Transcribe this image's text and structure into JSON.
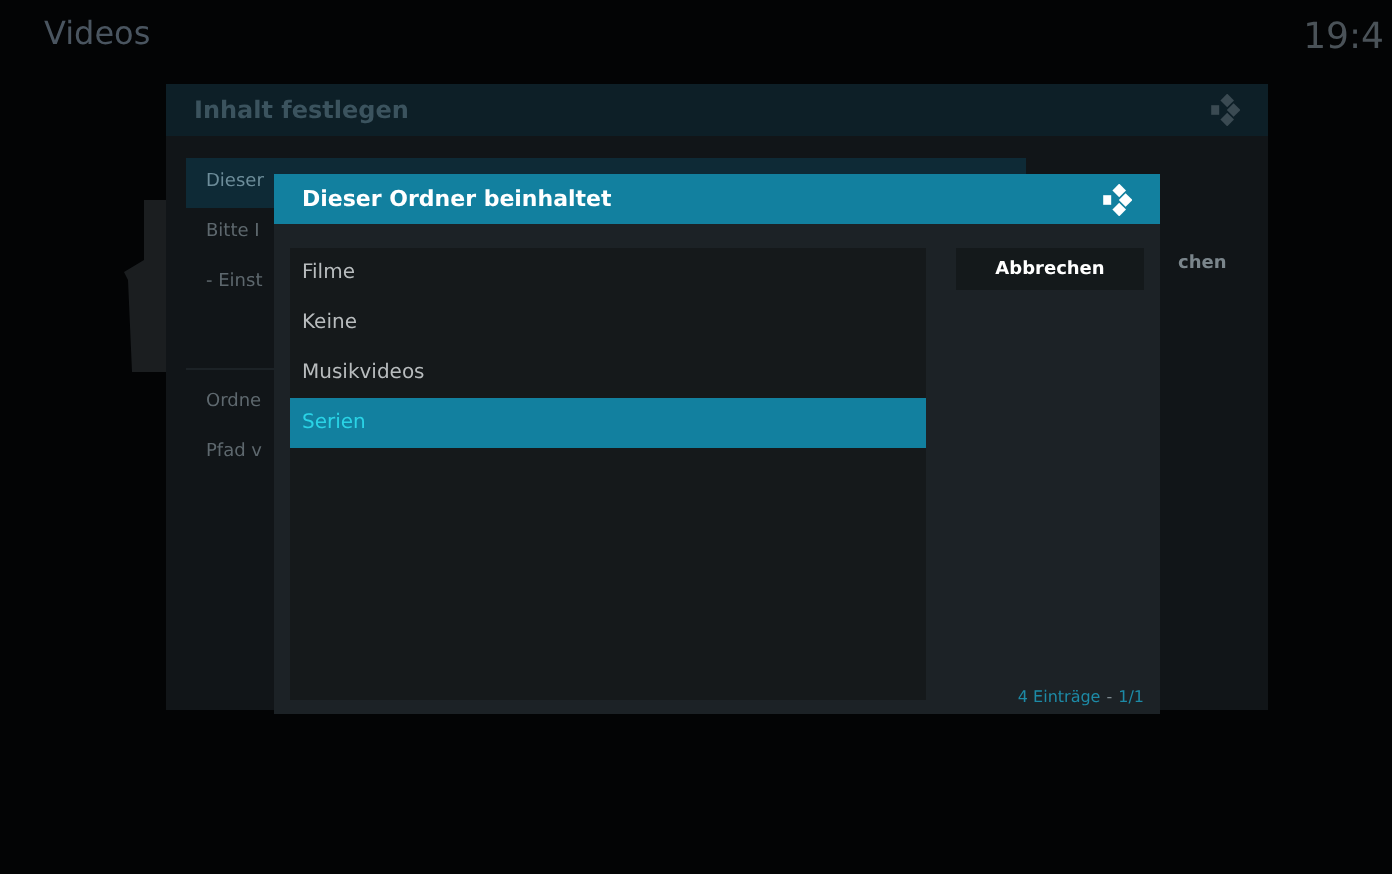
{
  "header": {
    "title": "Videos",
    "clock": "19:4"
  },
  "back_dialog": {
    "title": "Inhalt festlegen",
    "items": [
      {
        "label": "Dieser",
        "selected": true
      },
      {
        "label": "Bitte I",
        "selected": false
      },
      {
        "label": "- Einst",
        "selected": false
      },
      {
        "label": "Ordne",
        "selected": false
      },
      {
        "label": "Pfad v",
        "selected": false
      }
    ],
    "side_text": "chen"
  },
  "dialog": {
    "title": "Dieser Ordner beinhaltet",
    "items": [
      {
        "label": "Filme",
        "selected": false
      },
      {
        "label": "Keine",
        "selected": false
      },
      {
        "label": "Musikvideos",
        "selected": false
      },
      {
        "label": "Serien",
        "selected": true
      }
    ],
    "button": "Abbrechen",
    "count": "4 Einträge",
    "separator": "-",
    "page": "1/1"
  }
}
